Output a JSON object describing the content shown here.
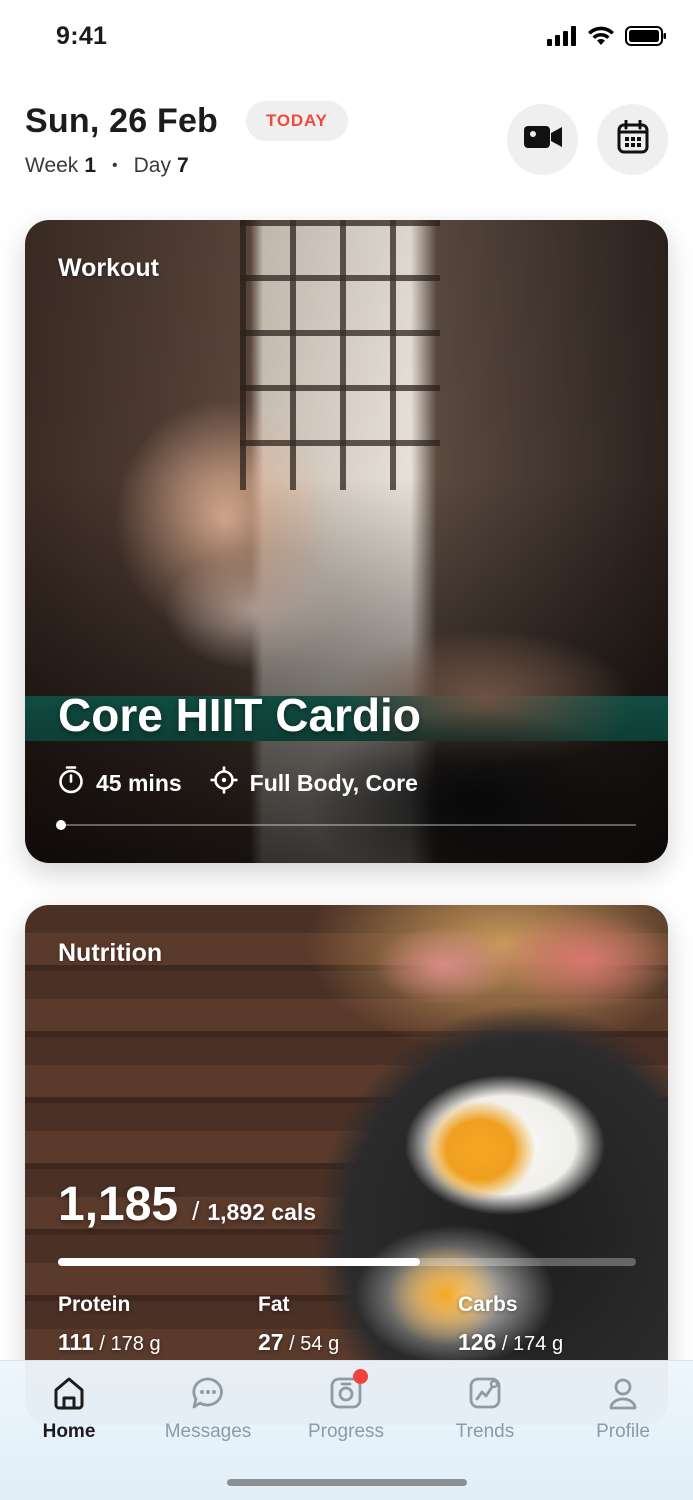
{
  "status_bar": {
    "time": "9:41"
  },
  "header": {
    "date": "Sun, 26 Feb",
    "today_badge": "TODAY",
    "week_label": "Week",
    "week_number": "1",
    "day_label": "Day",
    "day_number": "7"
  },
  "workout": {
    "section_label": "Workout",
    "title": "Core HIIT Cardio",
    "duration": "45 mins",
    "focus": "Full Body, Core"
  },
  "nutrition": {
    "section_label": "Nutrition",
    "calories_consumed": "1,185",
    "calories_total": "1,892 cals",
    "progress_fraction": 0.626,
    "macros": [
      {
        "label": "Protein",
        "value": "111",
        "target": "178 g"
      },
      {
        "label": "Fat",
        "value": "27",
        "target": "54 g"
      },
      {
        "label": "Carbs",
        "value": "126",
        "target": "174 g"
      }
    ]
  },
  "tabs": [
    {
      "label": "Home",
      "icon": "home-icon",
      "active": true
    },
    {
      "label": "Messages",
      "icon": "messages-icon",
      "active": false
    },
    {
      "label": "Progress",
      "icon": "progress-icon",
      "active": false,
      "badge": true
    },
    {
      "label": "Trends",
      "icon": "trends-icon",
      "active": false
    },
    {
      "label": "Profile",
      "icon": "profile-icon",
      "active": false
    }
  ],
  "colors": {
    "accent_red": "#ef4a3c",
    "tab_inactive": "#8e9aa6",
    "tabbar_bg": "#e0eef8"
  }
}
